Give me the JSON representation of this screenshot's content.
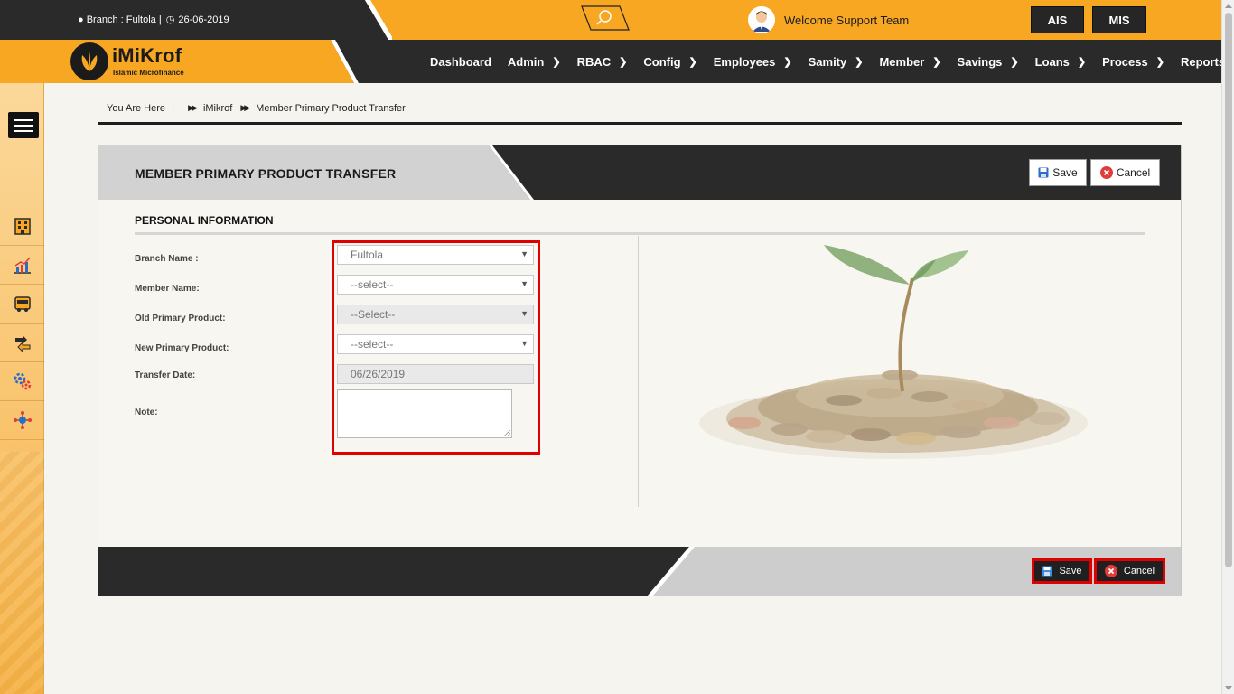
{
  "topbar": {
    "branch_label": "Branch : Fultola |",
    "date": "26-06-2019",
    "welcome": "Welcome Support Team",
    "systems": [
      "AIS",
      "MIS"
    ]
  },
  "brand": {
    "name": "iMiKrof",
    "tagline": "Islamic Microfinance"
  },
  "nav": {
    "items": [
      "Dashboard",
      "Admin",
      "RBAC",
      "Config",
      "Employees",
      "Samity",
      "Member",
      "Savings",
      "Loans",
      "Process",
      "Reports"
    ]
  },
  "sidebar": {
    "icons": [
      "building-icon",
      "chart-icon",
      "bus-icon",
      "transfer-icon",
      "settings-gears-icon",
      "network-icon"
    ]
  },
  "breadcrumb": {
    "prefix": "You Are Here",
    "colon": ":",
    "items": [
      "iMikrof",
      "Member Primary Product Transfer"
    ]
  },
  "panel": {
    "title": "MEMBER PRIMARY PRODUCT TRANSFER",
    "save_label": "Save",
    "cancel_label": "Cancel",
    "section_title": "PERSONAL INFORMATION"
  },
  "form": {
    "branch_label": "Branch Name :",
    "branch_value": "Fultola",
    "member_label": "Member Name:",
    "member_value": "--select--",
    "old_product_label": "Old Primary Product:",
    "old_product_value": "--Select--",
    "new_product_label": "New Primary Product:",
    "new_product_value": "--select--",
    "date_label": "Transfer Date:",
    "date_value": "06/26/2019",
    "note_label": "Note:"
  },
  "footer": {
    "save_label": "Save",
    "cancel_label": "Cancel"
  },
  "colors": {
    "accent": "#f8a722",
    "dark": "#2a2a2a",
    "highlight": "#e00000"
  }
}
